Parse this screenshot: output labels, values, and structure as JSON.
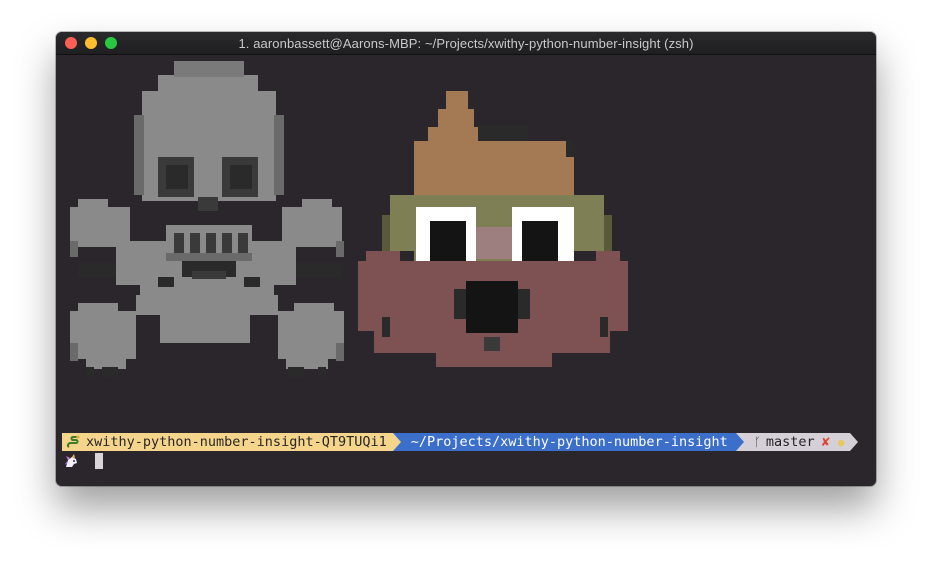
{
  "window": {
    "title": "1. aaronbassett@Aarons-MBP: ~/Projects/xwithy-python-number-insight (zsh)"
  },
  "prompt": {
    "venv": "xwithy-python-number-insight-QT9TUQi1",
    "path": "~/Projects/xwithy-python-number-insight",
    "branch": "master",
    "icons": {
      "venv": "python-snake-icon",
      "branch": "git-branch-icon",
      "dirty": "x-mark-icon",
      "prompt": "unicorn-icon"
    },
    "glyphs": {
      "branch": "ᚴ",
      "dirty": "✘",
      "dot": "●"
    }
  },
  "colors": {
    "terminal_bg": "#2b262c",
    "venv_segment": "#f5d58c",
    "path_segment": "#3b6fca",
    "git_segment": "#d5d0d8",
    "skull_main": "#8a8a8a",
    "poop_brown": "#a47a54",
    "poop_olive": "#7f7f55",
    "poop_mauve": "#7e5252"
  },
  "images": {
    "skull": "skull-and-crossbones-pixel-art",
    "poop": "pile-of-poo-pixel-art"
  }
}
